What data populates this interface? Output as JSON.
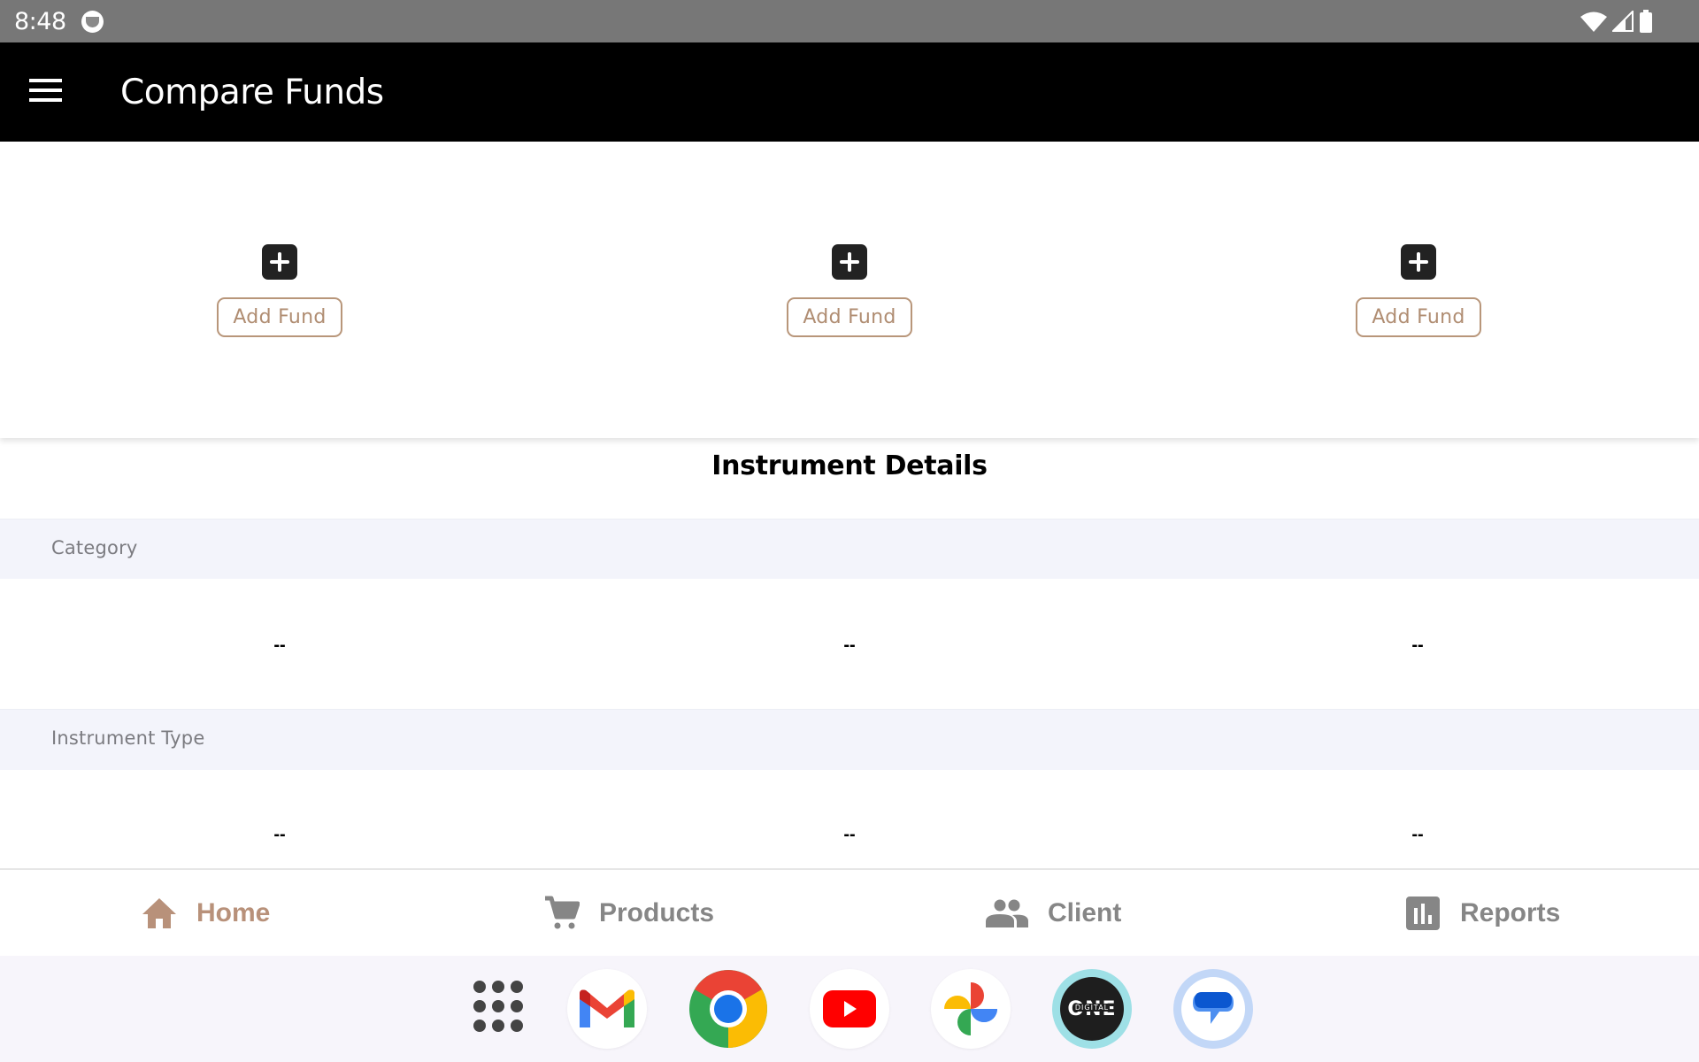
{
  "status_bar": {
    "time": "8:48",
    "notification_icon": "privacy-indicator-icon",
    "right_icons": [
      "wifi-icon",
      "cellular-signal-icon",
      "battery-icon"
    ]
  },
  "app_bar": {
    "menu_icon": "hamburger-menu-icon",
    "title": "Compare Funds"
  },
  "fund_slots": [
    {
      "icon": "plus-icon",
      "label": "Add Fund"
    },
    {
      "icon": "plus-icon",
      "label": "Add Fund"
    },
    {
      "icon": "plus-icon",
      "label": "Add Fund"
    }
  ],
  "details": {
    "title": "Instrument Details",
    "rows": [
      {
        "label": "Category",
        "values": [
          "--",
          "--",
          "--"
        ]
      },
      {
        "label": "Instrument Type",
        "values": [
          "--",
          "--",
          "--"
        ]
      }
    ]
  },
  "bottom_nav": {
    "items": [
      {
        "label": "Home",
        "icon": "home-icon",
        "active": true
      },
      {
        "label": "Products",
        "icon": "cart-icon",
        "active": false
      },
      {
        "label": "Client",
        "icon": "people-icon",
        "active": false
      },
      {
        "label": "Reports",
        "icon": "bar-chart-icon",
        "active": false
      }
    ],
    "active_color": "#b8917a",
    "inactive_color": "#868686"
  },
  "dock": {
    "apps": [
      "App drawer",
      "Gmail",
      "Chrome",
      "YouTube",
      "Google Photos",
      "ONE Digital",
      "Messages"
    ],
    "one_digital_text": {
      "big": "ONE",
      "small": "DIGITAL"
    }
  },
  "colors": {
    "app_bar": "#000000",
    "status_bar": "#777777",
    "accent": "#b8967a",
    "band_bg": "#f3f4fb"
  }
}
